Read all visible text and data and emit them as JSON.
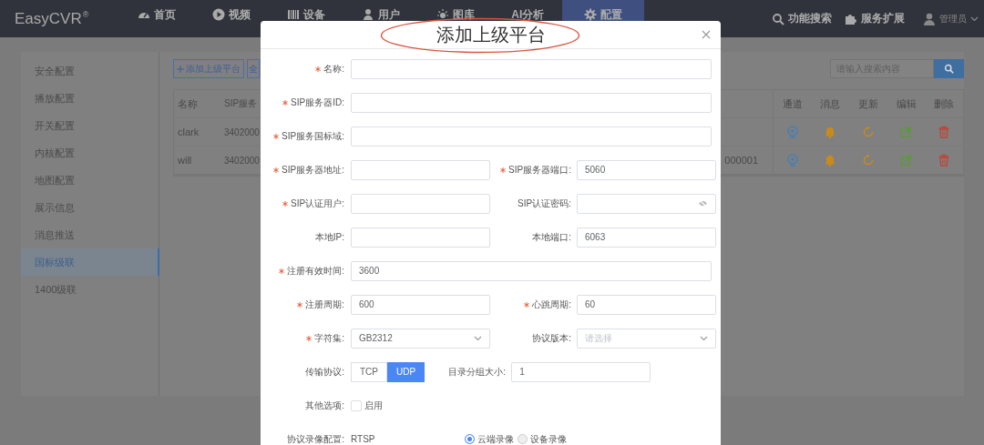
{
  "navbar": {
    "logo": "EasyCVR",
    "logo_mark": "®",
    "items": [
      {
        "label": "首页",
        "selected": false
      },
      {
        "label": "视频",
        "selected": false
      },
      {
        "label": "设备",
        "selected": false
      },
      {
        "label": "用户",
        "selected": false
      },
      {
        "label": "图库",
        "selected": false
      },
      {
        "label": "AI分析",
        "selected": false
      },
      {
        "label": "配置",
        "selected": true
      }
    ],
    "tools": [
      {
        "label": "功能搜索"
      },
      {
        "label": "服务扩展"
      }
    ],
    "user": "管理员"
  },
  "sidebar": {
    "items": [
      {
        "label": "安全配置",
        "selected": false
      },
      {
        "label": "播放配置",
        "selected": false
      },
      {
        "label": "开关配置",
        "selected": false
      },
      {
        "label": "内核配置",
        "selected": false
      },
      {
        "label": "地图配置",
        "selected": false
      },
      {
        "label": "展示信息",
        "selected": false
      },
      {
        "label": "消息推送",
        "selected": false
      },
      {
        "label": "国标级联",
        "selected": true
      },
      {
        "label": "1400级联",
        "selected": false
      }
    ]
  },
  "toolbar": {
    "add_button": "添加上级平台",
    "button_2": "全",
    "search": {
      "placeholder": "请输入搜索内容"
    }
  },
  "table": {
    "columns": [
      "名称",
      "SIP服务"
    ],
    "action_columns": [
      "通道",
      "消息",
      "更新",
      "编辑",
      "删除"
    ],
    "rows": [
      {
        "name": "clark",
        "column_2": "3402000"
      },
      {
        "name": "will",
        "column_2": "3402000",
        "column_3": "000001"
      }
    ]
  },
  "dialog": {
    "title": "添加上级平台",
    "rows": [
      [
        {
          "label": "名称:",
          "required": true,
          "kind": "text"
        }
      ],
      [
        {
          "label": "SIP服务器ID:",
          "required": true,
          "kind": "text"
        }
      ],
      [
        {
          "label": "SIP服务国标域:",
          "required": true,
          "kind": "text"
        }
      ],
      [
        {
          "label": "SIP服务器地址:",
          "required": true,
          "kind": "text"
        },
        {
          "label": "SIP服务器端口:",
          "required": true,
          "kind": "text",
          "value": "5060"
        }
      ],
      [
        {
          "label": "SIP认证用户:",
          "required": true,
          "kind": "text"
        },
        {
          "label": "SIP认证密码:",
          "required": false,
          "kind": "password"
        }
      ],
      [
        {
          "label": "本地IP:",
          "required": false,
          "kind": "text"
        },
        {
          "label": "本地端口:",
          "required": false,
          "kind": "text",
          "value": "6063"
        }
      ],
      [
        {
          "label": "注册有效时间:",
          "required": true,
          "kind": "text",
          "value": "3600"
        }
      ],
      [
        {
          "label": "注册周期:",
          "required": true,
          "kind": "text",
          "value": "600"
        },
        {
          "label": "心跳周期:",
          "required": true,
          "kind": "text",
          "value": "60"
        }
      ],
      [
        {
          "label": "字符集:",
          "required": true,
          "kind": "select",
          "value": "GB2312"
        },
        {
          "label": "协议版本:",
          "required": false,
          "kind": "select",
          "placeholder": "请选择"
        }
      ],
      [
        {
          "label": "传输协议:",
          "required": false,
          "kind": "segmented",
          "options": [
            {
              "label": "TCP",
              "selected": false
            },
            {
              "label": "UDP",
              "selected": true
            }
          ]
        },
        {
          "label": "目录分组大小:",
          "required": false,
          "kind": "text",
          "value": "1"
        }
      ],
      [
        {
          "label": "其他选项:",
          "required": false,
          "kind": "checkbox",
          "option": "启用",
          "checked": false
        }
      ],
      [
        {
          "label": "协议录像配置:",
          "required": false,
          "kind": "static",
          "value": "RTSP"
        },
        {
          "kind": "radio",
          "options": [
            {
              "label": "云端录像",
              "selected": true
            },
            {
              "label": "设备录像",
              "selected": false
            }
          ]
        }
      ]
    ]
  }
}
